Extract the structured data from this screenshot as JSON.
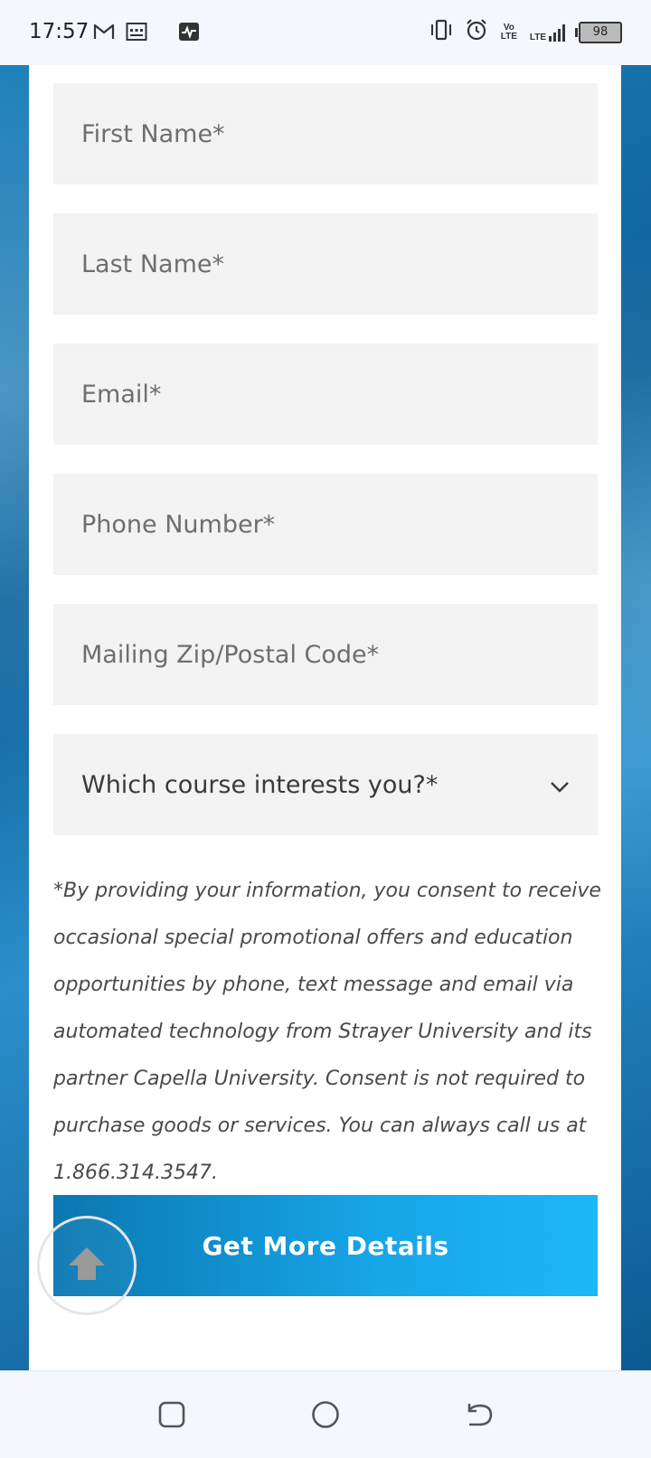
{
  "status_bar": {
    "time": "17:57",
    "battery": "98",
    "left_icons": [
      "gmail-icon",
      "calendar-icon",
      "activity-icon"
    ],
    "right_icons": [
      "vibrate-icon",
      "alarm-icon",
      "volte-icon",
      "lte-signal-icon",
      "battery-icon"
    ],
    "volte_label": "Vo LTE",
    "lte_label": "LTE"
  },
  "form": {
    "first_name_placeholder": "First Name*",
    "last_name_placeholder": "Last Name*",
    "email_placeholder": "Email*",
    "phone_placeholder": "Phone Number*",
    "zip_placeholder": "Mailing Zip/Postal Code*",
    "course_select_label": "Which course interests you?*"
  },
  "consent_text": "*By providing your information, you consent to receive occasional special promotional offers and education opportunities by phone, text message and email via automated technology from Strayer University and its partner Capella University. Consent is not required to purchase goods or services. You can always call us at 1.866.314.3547.",
  "cta": {
    "label": "Get More Details"
  },
  "colors": {
    "cta_start": "#0a77b0",
    "cta_end": "#1cb7f7",
    "field_bg": "#f3f3f3",
    "page_bg": "#1c7fb9"
  },
  "nav": {
    "icons": [
      "recent-apps-icon",
      "home-icon",
      "back-icon"
    ]
  }
}
